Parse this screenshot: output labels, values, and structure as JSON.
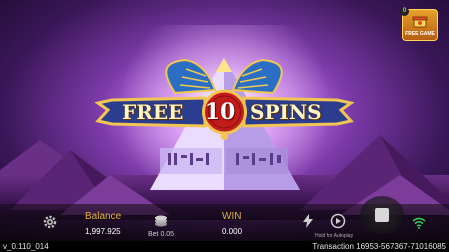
{
  "banner": {
    "word_left": "FREE",
    "number": "10",
    "word_right": "SPINS"
  },
  "free_game_button": {
    "label": "FREE GAME",
    "count": "0"
  },
  "hud": {
    "balance_label": "Balance",
    "balance_value": "1,997.925",
    "bet_label": "Bet 0.05",
    "win_label": "WIN",
    "win_value": "0.000",
    "hold_hint": "Hold for Autoplay"
  },
  "footer": {
    "version": "v_0.110_014",
    "transaction": "Transaction 16953-567367-71016085"
  },
  "icons": [
    "settings-icon",
    "chips-icon",
    "turbo-icon",
    "autoplay-icon",
    "stop-icon",
    "wifi-icon",
    "free-game-icon"
  ],
  "colors": {
    "gold": "#e0b23a",
    "banner_blue": "#2a3d8f",
    "banner_red": "#c21c1c",
    "sky": "#7b3aa8"
  }
}
